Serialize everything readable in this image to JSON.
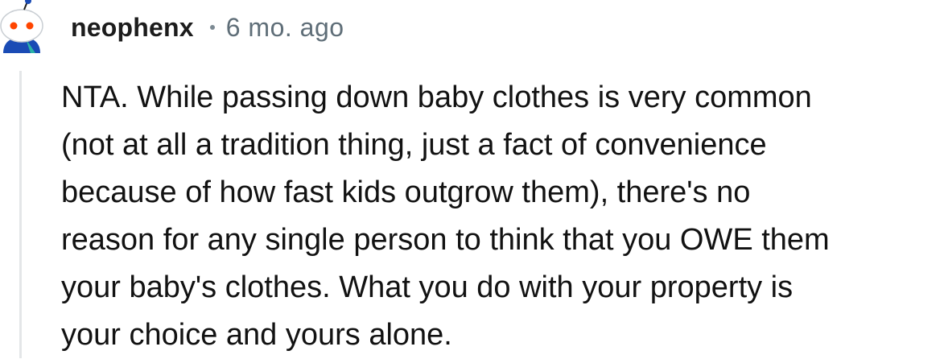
{
  "comment": {
    "username": "neophenx",
    "separator": "•",
    "timestamp": "6 mo. ago",
    "avatar": "snoo-avatar",
    "body": "NTA. While passing down baby clothes is very common\n(not at all a tradition thing, just a fact of convenience\nbecause of how fast kids outgrow them), there's no\nreason for any single person to think that you OWE them\nyour baby's clothes. What you do with your property is\nyour choice and yours alone."
  },
  "colors": {
    "username": "#1c1c1c",
    "timestamp": "#5f6e78",
    "thread_line": "#e4e6e8",
    "avatar_body": "#1a4bb5",
    "avatar_head": "#ffffff"
  }
}
